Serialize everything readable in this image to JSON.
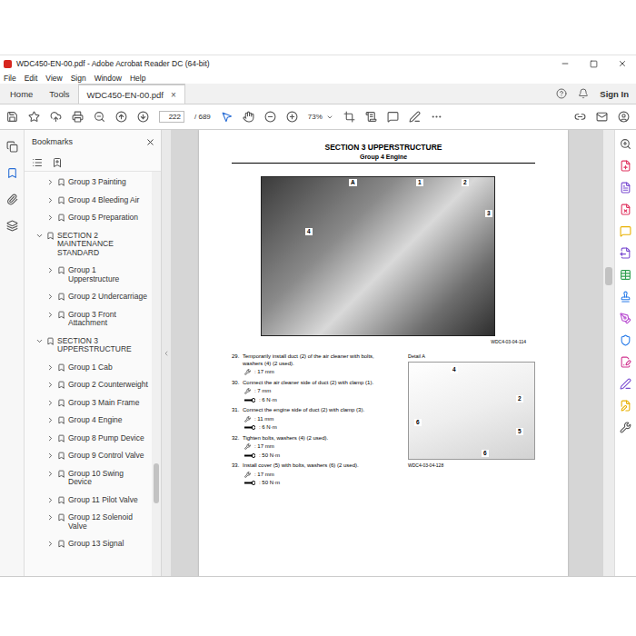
{
  "window": {
    "title": "WDC450-EN-00.pdf - Adobe Acrobat Reader DC (64-bit)"
  },
  "menu": [
    "File",
    "Edit",
    "View",
    "Sign",
    "Window",
    "Help"
  ],
  "tabs": [
    {
      "label": "Home",
      "selected": false
    },
    {
      "label": "Tools",
      "selected": false
    },
    {
      "label": "WDC450-EN-00.pdf",
      "selected": true,
      "close": "×"
    }
  ],
  "account": {
    "sign_in": "Sign In"
  },
  "toolbar": {
    "page": "222",
    "total": "/ 689",
    "zoom": "73%"
  },
  "bookmarks": {
    "title": "Bookmarks",
    "scroll_position": 0.8,
    "items": [
      {
        "label": "Group 3 Painting",
        "level": 2,
        "expanded": false
      },
      {
        "label": "Group 4 Bleeding Air",
        "level": 2,
        "expanded": false
      },
      {
        "label": "Group 5 Preparation",
        "level": 2,
        "expanded": false
      },
      {
        "label": "SECTION 2 MAINTENANCE STANDARD",
        "level": 1,
        "expanded": true
      },
      {
        "label": "Group 1 Upperstructure",
        "level": 2,
        "expanded": false
      },
      {
        "label": "Group 2 Undercarriage",
        "level": 2,
        "expanded": false
      },
      {
        "label": "Group 3 Front Attachment",
        "level": 2,
        "expanded": false
      },
      {
        "label": "SECTION 3 UPPERSTRUCTURE",
        "level": 1,
        "expanded": true
      },
      {
        "label": "Group 1 Cab",
        "level": 2,
        "expanded": false
      },
      {
        "label": "Group 2 Counterweight",
        "level": 2,
        "expanded": false
      },
      {
        "label": "Group 3 Main Frame",
        "level": 2,
        "expanded": false
      },
      {
        "label": "Group 4 Engine",
        "level": 2,
        "expanded": false
      },
      {
        "label": "Group 8 Pump Device",
        "level": 2,
        "expanded": false
      },
      {
        "label": "Group 9 Control Valve",
        "level": 2,
        "expanded": false
      },
      {
        "label": "Group 10 Swing Device",
        "level": 2,
        "expanded": false
      },
      {
        "label": "Group 11 Pilot Valve",
        "level": 2,
        "expanded": false
      },
      {
        "label": "Group 12 Solenoid Valve",
        "level": 2,
        "expanded": false
      },
      {
        "label": "Group 13 Signal",
        "level": 2,
        "expanded": false
      }
    ]
  },
  "document": {
    "scroll_position": 0.32,
    "section": "SECTION 3 UPPERSTRUCTURE",
    "group": "Group 4 Engine",
    "figure": {
      "callouts": [
        "A",
        "1",
        "2",
        "3",
        "4"
      ],
      "caption": "WDC4-03-04-114"
    },
    "steps": [
      {
        "number": "29.",
        "text": "Temporarily install duct (2) of the air cleaner with bolts, washers (4) (2 used).",
        "specs": [
          {
            "kind": "wrench",
            "value": ": 17 mm"
          }
        ]
      },
      {
        "number": "30.",
        "text": "Connect the air cleaner side of duct (2) with clamp (1).",
        "specs": [
          {
            "kind": "wrench",
            "value": ": 7 mm"
          },
          {
            "kind": "torque",
            "value": ": 6 N·m"
          }
        ]
      },
      {
        "number": "31.",
        "text": "Connect the engine side of duct (2) with clamp (3).",
        "specs": [
          {
            "kind": "wrench",
            "value": ": 11 mm"
          },
          {
            "kind": "torque",
            "value": ": 6 N·m"
          }
        ]
      },
      {
        "number": "32.",
        "text": "Tighten bolts, washers (4) (2 used).",
        "specs": [
          {
            "kind": "wrench",
            "value": ": 17 mm"
          },
          {
            "kind": "torque",
            "value": ": 50 N·m"
          }
        ]
      },
      {
        "number": "33.",
        "text": "Install cover (5) with bolts, washers (6) (2 used).",
        "specs": [
          {
            "kind": "wrench",
            "value": ": 17 mm"
          },
          {
            "kind": "torque",
            "value": ": 50 N·m"
          }
        ]
      }
    ],
    "detail": {
      "title": "Detail A",
      "callouts": [
        "4",
        "2",
        "5",
        "6",
        "6"
      ],
      "caption": "WDC4-03-04-128"
    }
  }
}
